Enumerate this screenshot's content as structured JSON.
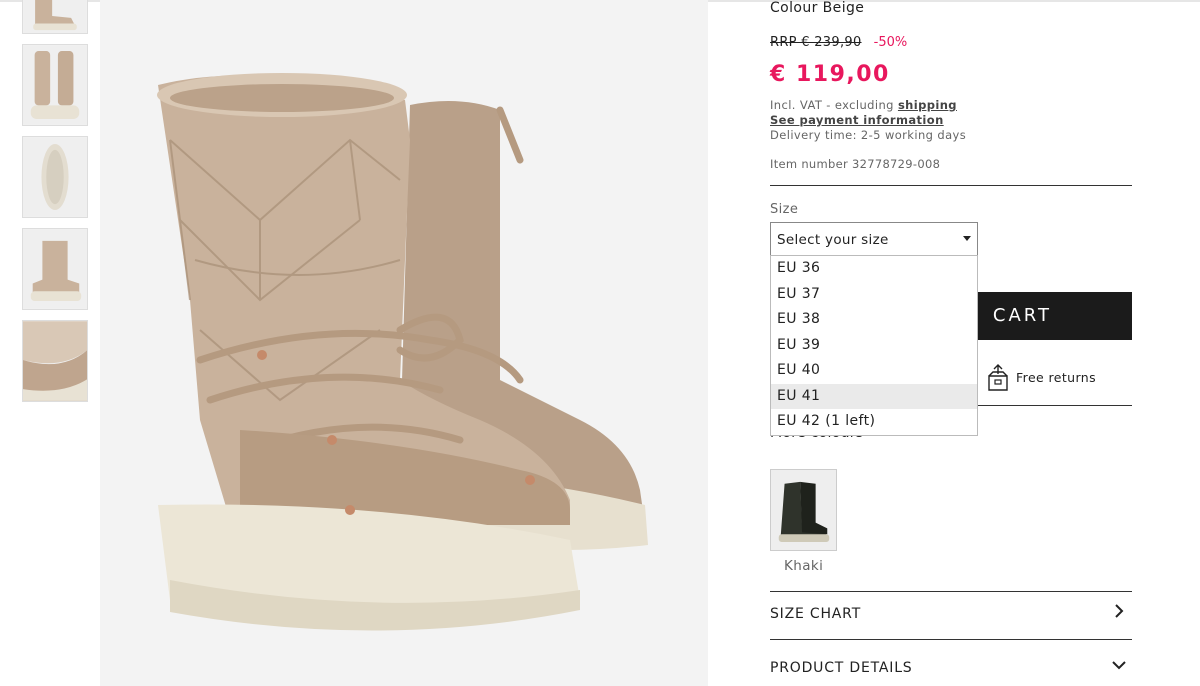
{
  "product": {
    "colour": "Colour Beige",
    "rrp": "RRP € 239,90",
    "discount": "-50%",
    "price": "€ 119,00",
    "vat_prefix": "Incl. VAT - excluding",
    "vat_link": "shipping",
    "payment_link": "See payment information",
    "delivery": "Delivery time: 2-5 working days",
    "item_number": "Item number 32778729-008"
  },
  "size": {
    "label": "Size",
    "placeholder": "Select your size",
    "options": [
      "EU 36",
      "EU 37",
      "EU 38",
      "EU 39",
      "EU 40",
      "EU 41",
      "EU 42 (1 left)"
    ],
    "highlighted_index": 5
  },
  "cart": {
    "label": "CART"
  },
  "returns": {
    "label": "Free returns"
  },
  "colours": {
    "heading": "More colours",
    "swatches": [
      {
        "name": "Khaki"
      }
    ]
  },
  "accordions": [
    {
      "label": "SIZE CHART",
      "icon": "chevron-right-icon"
    },
    {
      "label": "PRODUCT DETAILS",
      "icon": "chevron-down-icon"
    }
  ],
  "colors": {
    "accent": "#e8175d",
    "button": "#1b1b1b",
    "image_bg": "#f3f3f3",
    "boot": "#c9b29c"
  }
}
